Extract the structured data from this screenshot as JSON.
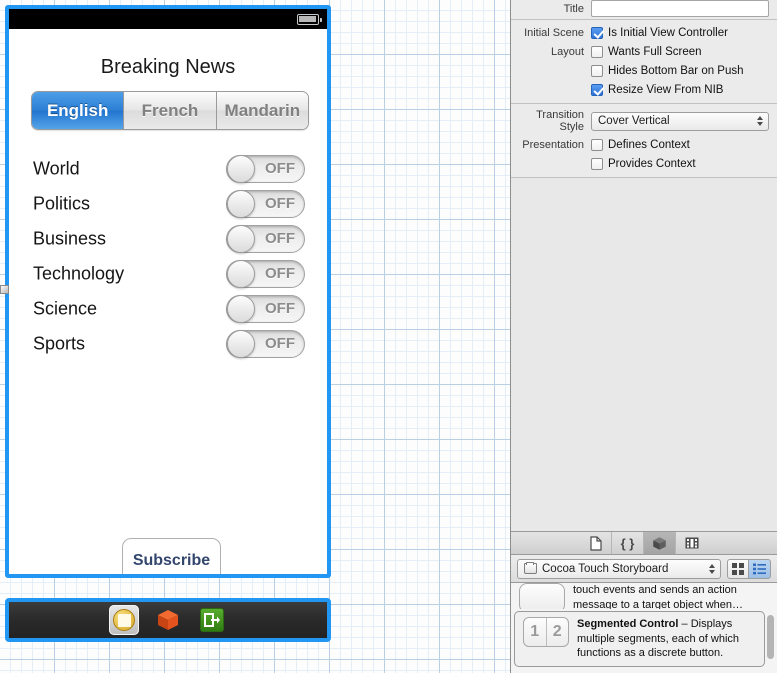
{
  "canvas": {
    "device": {
      "status_bar": {
        "battery_icon": "battery-icon"
      },
      "title": "Breaking News",
      "segmented_control": {
        "segments": [
          {
            "label": "English",
            "selected": true
          },
          {
            "label": "French",
            "selected": false
          },
          {
            "label": "Mandarin",
            "selected": false
          }
        ]
      },
      "switch_rows": [
        {
          "label": "World",
          "state": "OFF"
        },
        {
          "label": "Politics",
          "state": "OFF"
        },
        {
          "label": "Business",
          "state": "OFF"
        },
        {
          "label": "Technology",
          "state": "OFF"
        },
        {
          "label": "Science",
          "state": "OFF"
        },
        {
          "label": "Sports",
          "state": "OFF"
        }
      ],
      "button": {
        "label": "Subscribe"
      }
    },
    "dock": {
      "icons": [
        {
          "name": "view-controller-icon",
          "selected": true
        },
        {
          "name": "first-responder-cube-icon",
          "selected": false
        },
        {
          "name": "exit-segue-icon",
          "selected": false
        }
      ]
    },
    "selection_color": "#2196f3",
    "grid_minor_color": "#e3eef8",
    "grid_major_color": "#b9cfe4"
  },
  "inspector": {
    "title_row": {
      "label": "Title",
      "value": ""
    },
    "view_controller": {
      "initial_scene_label": "Initial Scene",
      "initial_scene_checkbox": {
        "label": "Is Initial View Controller",
        "checked": true
      },
      "layout_label": "Layout",
      "layout_checkboxes": [
        {
          "label": "Wants Full Screen",
          "checked": false
        },
        {
          "label": "Hides Bottom Bar on Push",
          "checked": false
        },
        {
          "label": "Resize View From NIB",
          "checked": true
        }
      ]
    },
    "transition": {
      "style_label": "Transition Style",
      "style_value": "Cover Vertical",
      "presentation_label": "Presentation",
      "presentation_checkboxes": [
        {
          "label": "Defines Context",
          "checked": false
        },
        {
          "label": "Provides Context",
          "checked": false
        }
      ]
    },
    "accent_color": "#2e73d6"
  },
  "library": {
    "tabs": [
      {
        "name": "file-template-library-tab",
        "glyph": "document-icon",
        "selected": false
      },
      {
        "name": "code-snippet-library-tab",
        "glyph": "braces-icon",
        "selected": false
      },
      {
        "name": "object-library-tab",
        "glyph": "cube-icon",
        "selected": true
      },
      {
        "name": "media-library-tab",
        "glyph": "film-icon",
        "selected": false
      }
    ],
    "selector": {
      "value": "Cocoa Touch Storyboard",
      "folder_icon": "folder-icon"
    },
    "view_modes": [
      {
        "name": "grid-view-button",
        "selected": false
      },
      {
        "name": "list-view-button",
        "selected": true
      }
    ],
    "items": [
      {
        "clipped": true,
        "description_line1": "touch events and sends an action",
        "description_line2": "message to a target object when…"
      },
      {
        "selected": true,
        "thumb_left": "1",
        "thumb_right": "2",
        "title": "Segmented Control",
        "dash": " – ",
        "description": "Displays multiple segments, each of which functions as a discrete button."
      }
    ]
  }
}
